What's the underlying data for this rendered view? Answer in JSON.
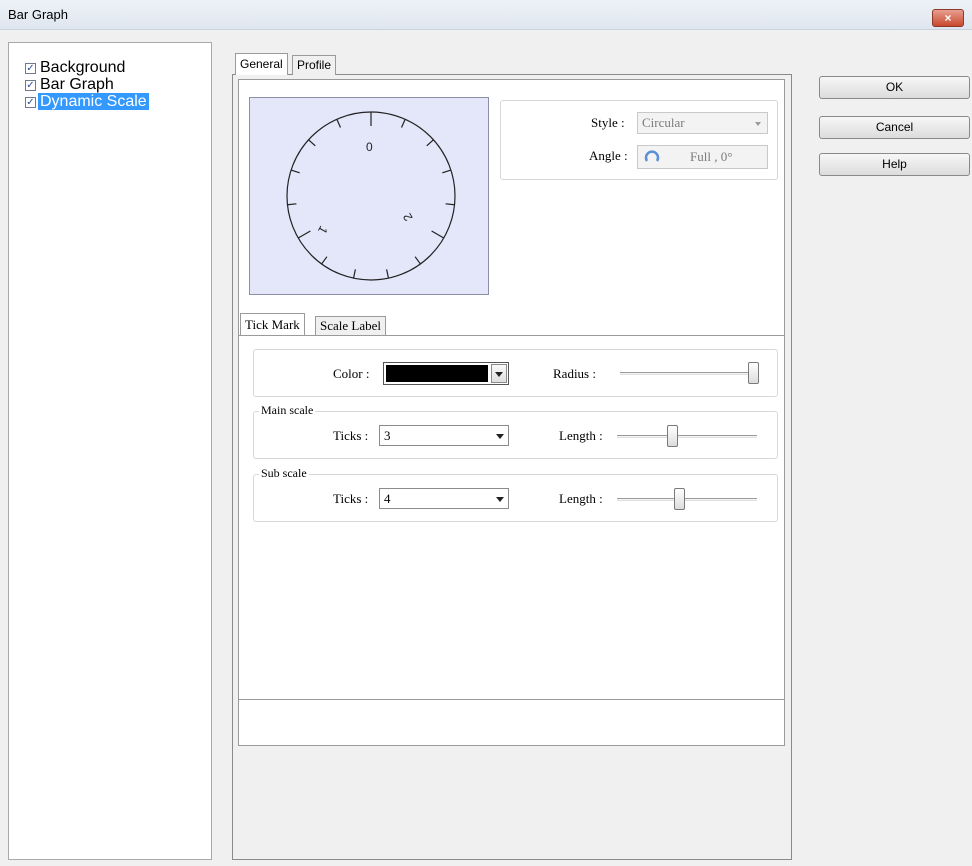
{
  "window": {
    "title": "Bar Graph",
    "close_glyph": "×"
  },
  "tree": {
    "items": [
      {
        "label": "Background",
        "checked": true
      },
      {
        "label": "Bar Graph",
        "checked": true
      },
      {
        "label": "Dynamic Scale",
        "checked": true,
        "selected": true
      }
    ]
  },
  "tabs": {
    "general": "General",
    "profile": "Profile",
    "active": "General"
  },
  "preview": {
    "labels": [
      "0",
      "1",
      "2"
    ]
  },
  "style_group": {
    "style_label": "Style :",
    "style_value": "Circular",
    "angle_label": "Angle :",
    "angle_value": "Full , 0°"
  },
  "sub_tabs": {
    "tick_mark": "Tick Mark",
    "scale_label": "Scale Label",
    "active": "Tick Mark"
  },
  "tick_mark": {
    "color_label": "Color :",
    "color_value": "#000000",
    "radius_label": "Radius :",
    "radius_level": 1.0,
    "main_scale": {
      "title": "Main scale",
      "ticks_label": "Ticks :",
      "ticks_value": "3",
      "length_label": "Length :",
      "length_level": 0.4
    },
    "sub_scale": {
      "title": "Sub scale",
      "ticks_label": "Ticks :",
      "ticks_value": "4",
      "length_label": "Length :",
      "length_level": 0.45
    }
  },
  "buttons": {
    "ok": "OK",
    "cancel": "Cancel",
    "help": "Help"
  },
  "colors": {
    "selection": "#3399ff",
    "preview_bg": "#e4e6fa"
  }
}
